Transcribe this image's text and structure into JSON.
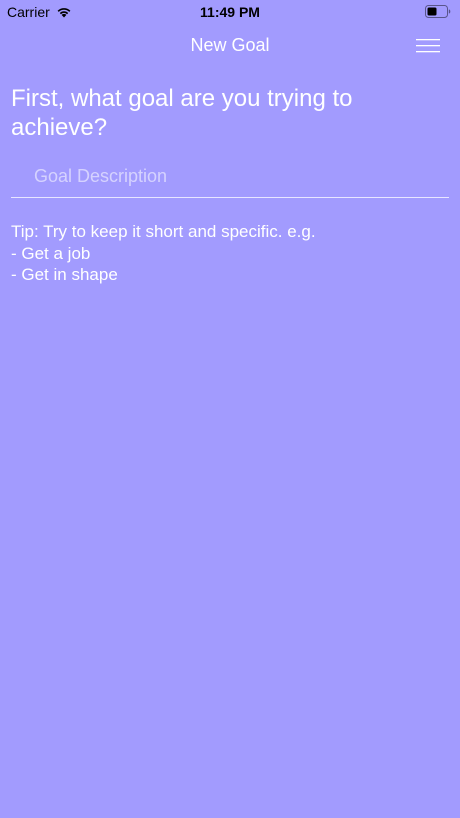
{
  "status_bar": {
    "carrier": "Carrier",
    "time": "11:49 PM",
    "wifi_icon": "wifi-icon",
    "battery_icon": "battery-icon"
  },
  "nav": {
    "title": "New Goal",
    "menu_icon": "hamburger-menu-icon"
  },
  "main": {
    "question": "First, what goal are you trying to achieve?",
    "goal_input": {
      "value": "",
      "placeholder": "Goal Description"
    },
    "tip": {
      "line1": "Tip: Try to keep it short and specific. e.g.",
      "line2": "- Get a job",
      "line3": "- Get in shape"
    }
  },
  "colors": {
    "background": "#a29bfe",
    "text": "#ffffff"
  }
}
